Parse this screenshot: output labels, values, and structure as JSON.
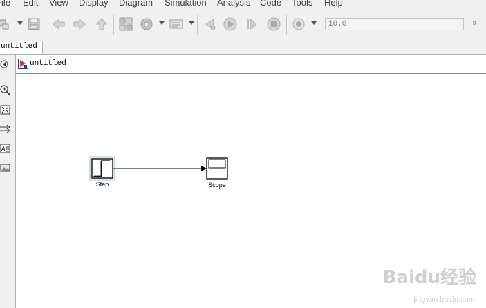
{
  "menu": {
    "items": [
      "File",
      "Edit",
      "View",
      "Display",
      "Diagram",
      "Simulation",
      "Analysis",
      "Code",
      "Tools",
      "Help"
    ]
  },
  "toolbar": {
    "stop_time": "10.0",
    "overflow": "»"
  },
  "tabs": [
    {
      "label": "untitled"
    }
  ],
  "address": {
    "model_name": "untitled"
  },
  "blocks": {
    "step": {
      "label": "Step"
    },
    "scope": {
      "label": "Scope"
    }
  },
  "watermark": {
    "brand": "Baidu经验",
    "url": "jingyan.baidu.com"
  }
}
